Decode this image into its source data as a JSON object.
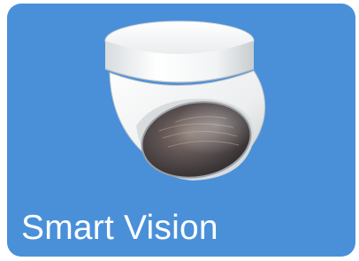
{
  "tile": {
    "label": "Smart Vision",
    "icon": "dome-security-camera-icon",
    "background_color": "#4a90d9",
    "label_color": "#ffffff"
  }
}
